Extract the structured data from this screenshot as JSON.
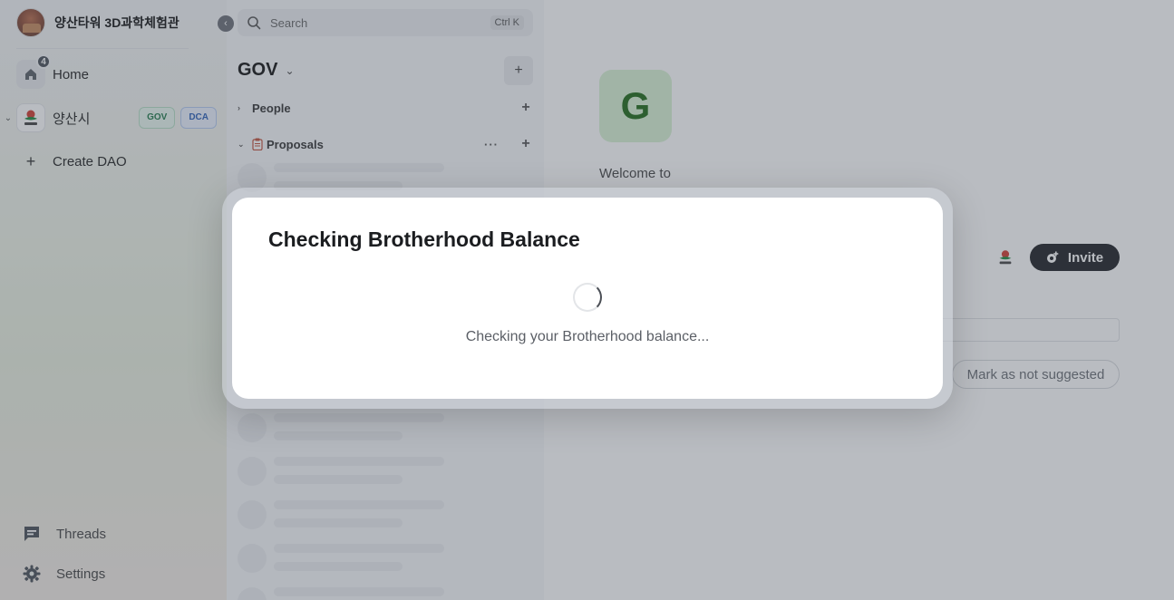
{
  "sidebar": {
    "org_name": "양산타워 3D과학체험관",
    "home_label": "Home",
    "home_badge": "4",
    "dao": {
      "name": "양산시",
      "tags": [
        "GOV",
        "DCA"
      ]
    },
    "create_label": "Create DAO",
    "threads_label": "Threads",
    "settings_label": "Settings"
  },
  "channels": {
    "search_placeholder": "Search",
    "search_shortcut": "Ctrl K",
    "title": "GOV",
    "sections": [
      {
        "name": "People"
      },
      {
        "name": "Proposals",
        "more": "···"
      }
    ]
  },
  "main": {
    "avatar_letter": "G",
    "welcome": "Welcome to",
    "invite_label": "Invite",
    "mark_label": "Mark as not suggested"
  },
  "modal": {
    "title": "Checking Brotherhood Balance",
    "message": "Checking your Brotherhood balance..."
  },
  "colors": {
    "accent_dark": "#1d2024",
    "gov_tag": "#1f7a4a",
    "dca_tag": "#2b5fb8",
    "g_avatar_bg": "#d9f3d3",
    "g_avatar_fg": "#1d6a16"
  }
}
